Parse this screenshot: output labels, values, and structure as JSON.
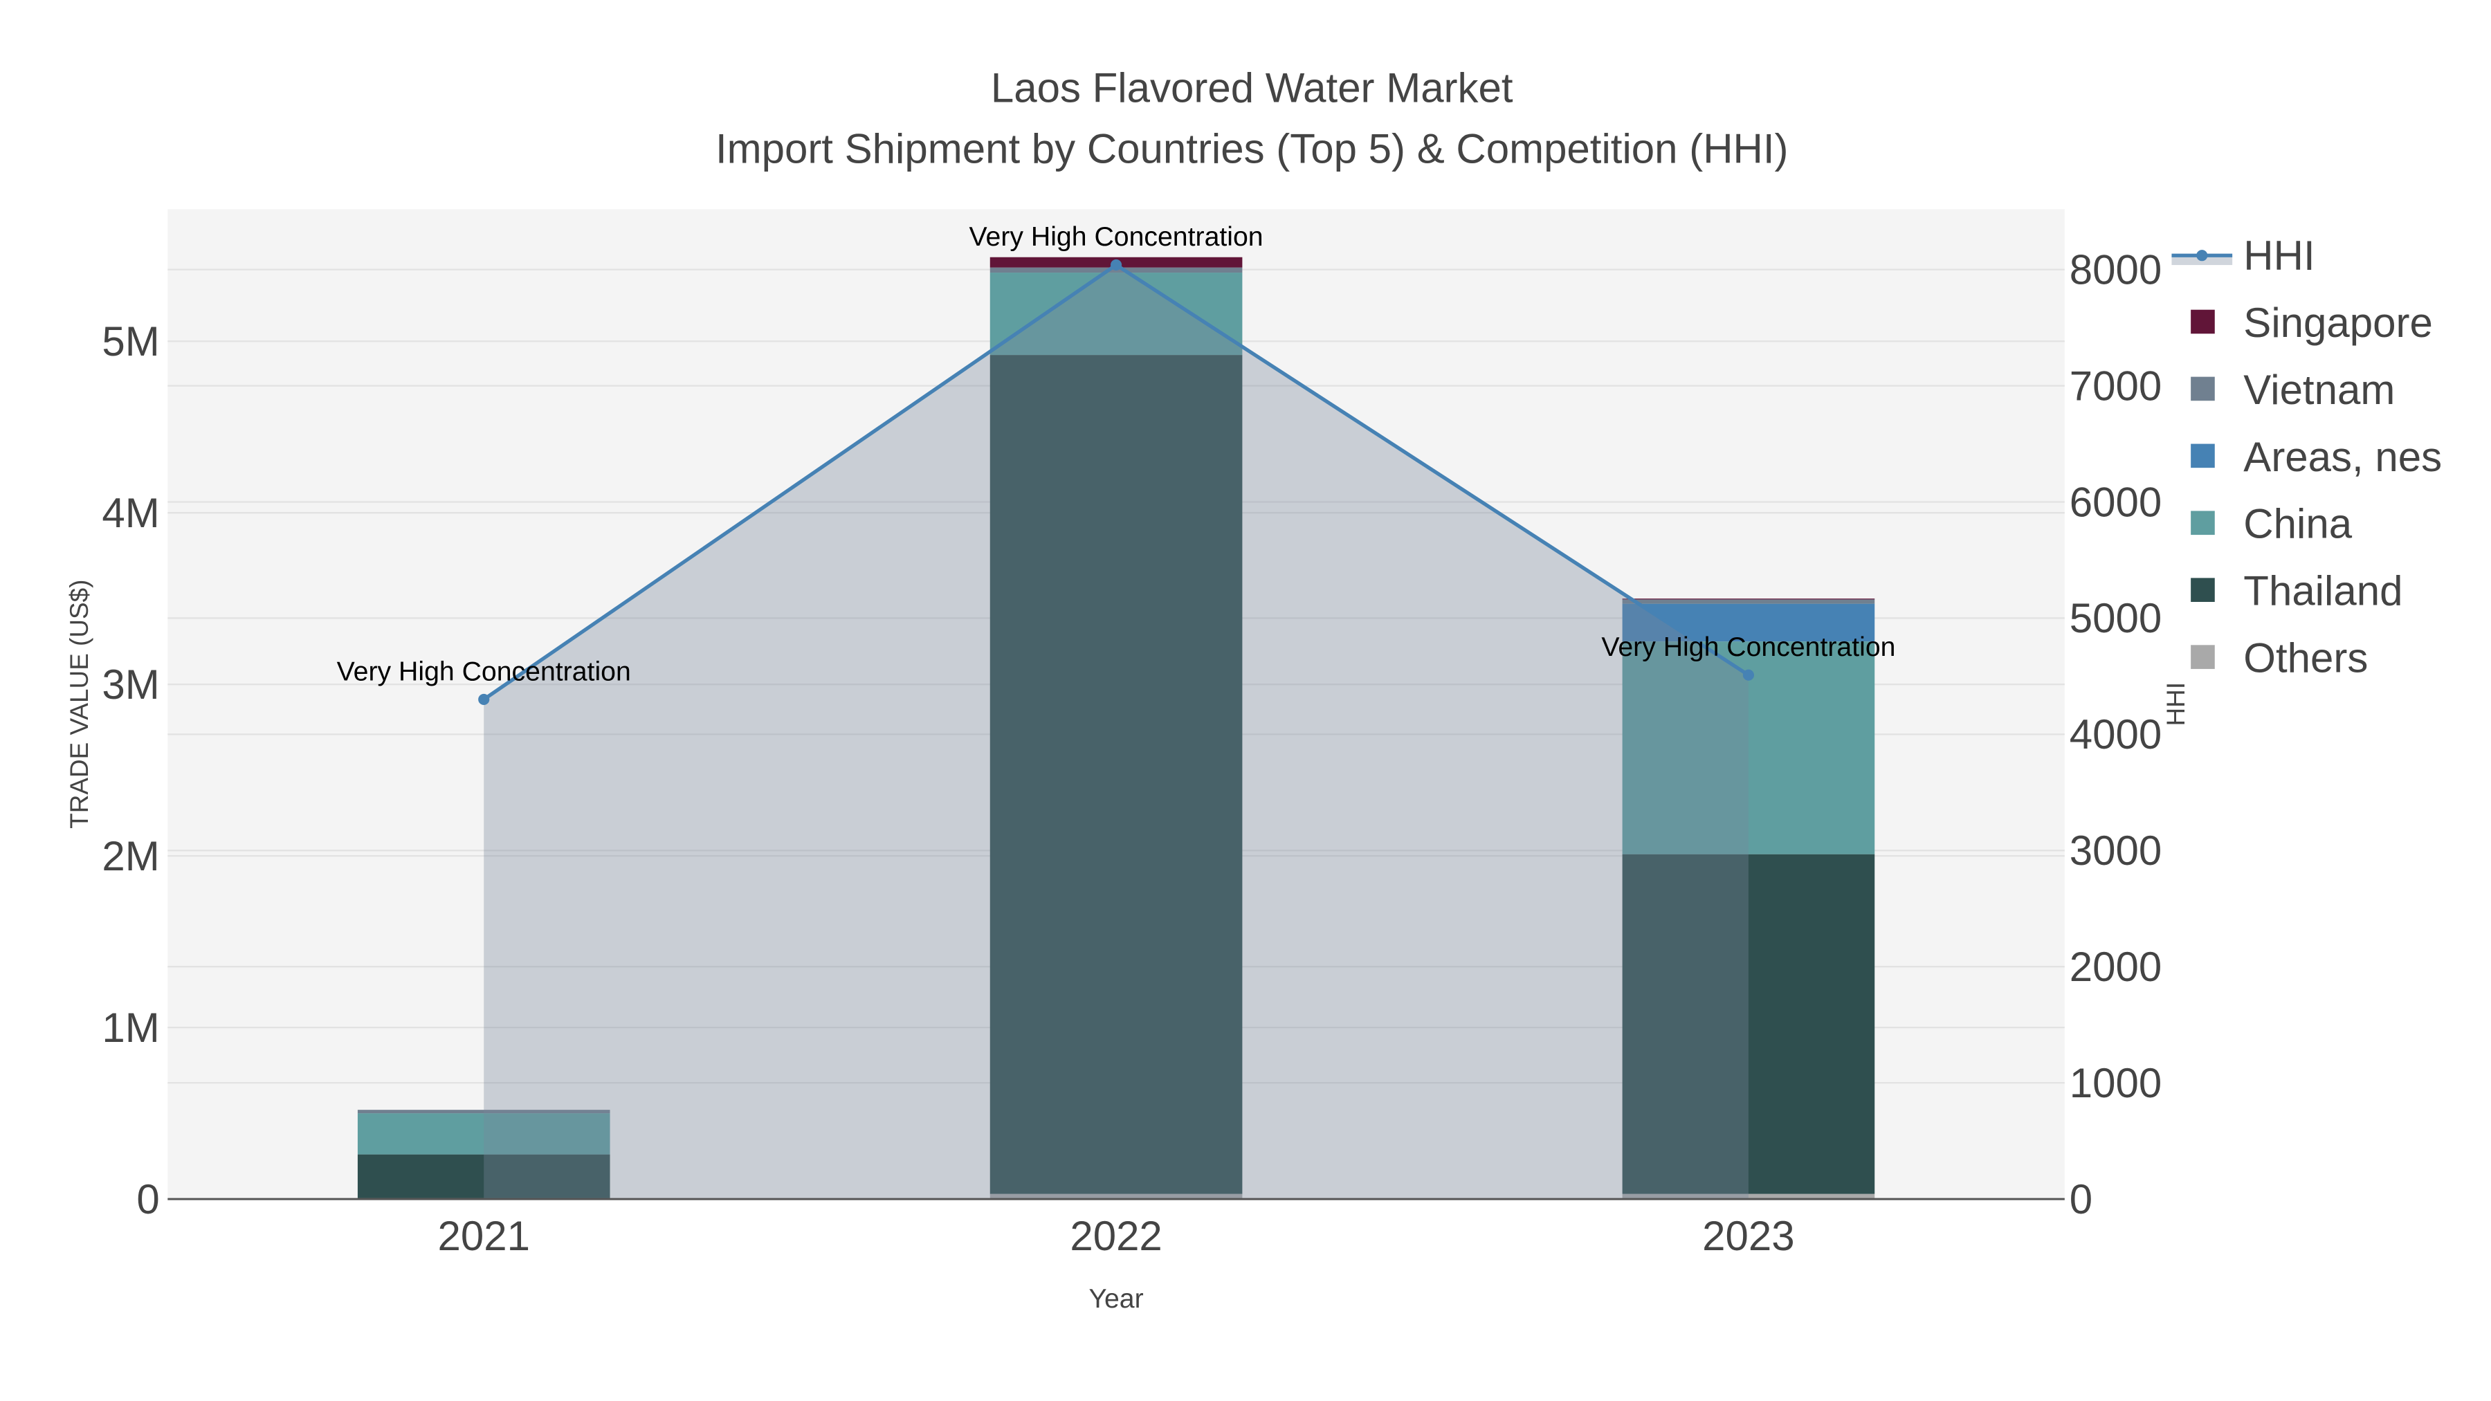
{
  "chart_data": {
    "type": "bar",
    "stacked": true,
    "title": "Laos Flavored Water Market",
    "subtitle": "Import Shipment by Countries (Top 5) & Competition (HHI)",
    "xlabel": "Year",
    "ylabel": "TRADE VALUE (US$)",
    "y2label": "HHI",
    "categories": [
      "2021",
      "2022",
      "2023"
    ],
    "ylim": [
      0,
      5770000
    ],
    "y2lim": [
      0,
      8520
    ],
    "yticks": [
      {
        "v": 0,
        "label": "0"
      },
      {
        "v": 1000000,
        "label": "1M"
      },
      {
        "v": 2000000,
        "label": "2M"
      },
      {
        "v": 3000000,
        "label": "3M"
      },
      {
        "v": 4000000,
        "label": "4M"
      },
      {
        "v": 5000000,
        "label": "5M"
      }
    ],
    "y2ticks": [
      {
        "v": 0,
        "label": "0"
      },
      {
        "v": 1000,
        "label": "1000"
      },
      {
        "v": 2000,
        "label": "2000"
      },
      {
        "v": 3000,
        "label": "3000"
      },
      {
        "v": 4000,
        "label": "4000"
      },
      {
        "v": 5000,
        "label": "5000"
      },
      {
        "v": 6000,
        "label": "6000"
      },
      {
        "v": 7000,
        "label": "7000"
      },
      {
        "v": 8000,
        "label": "8000"
      }
    ],
    "series": [
      {
        "name": "Others",
        "color": "#a9a9a9",
        "values": [
          5000,
          30000,
          30000
        ]
      },
      {
        "name": "Thailand",
        "color": "#2f4f4f",
        "values": [
          255000,
          4890000,
          1980000
        ]
      },
      {
        "name": "China",
        "color": "#5f9ea0",
        "values": [
          240000,
          480000,
          1240000
        ]
      },
      {
        "name": "Areas, nes",
        "color": "#4682b4",
        "values": [
          0,
          0,
          220000
        ]
      },
      {
        "name": "Vietnam",
        "color": "#708090",
        "values": [
          20000,
          30000,
          25000
        ]
      },
      {
        "name": "Singapore",
        "color": "#611538",
        "values": [
          0,
          60000,
          5000
        ]
      }
    ],
    "hhi": {
      "name": "HHI",
      "color": "#4682b4",
      "values": [
        4300,
        8040,
        4510
      ]
    },
    "annotations": [
      "Very High Concentration",
      "Very High Concentration",
      "Very High Concentration"
    ],
    "legend": [
      "HHI",
      "Singapore",
      "Vietnam",
      "Areas, nes",
      "China",
      "Thailand",
      "Others"
    ],
    "legend_position": "right",
    "grid": true
  }
}
